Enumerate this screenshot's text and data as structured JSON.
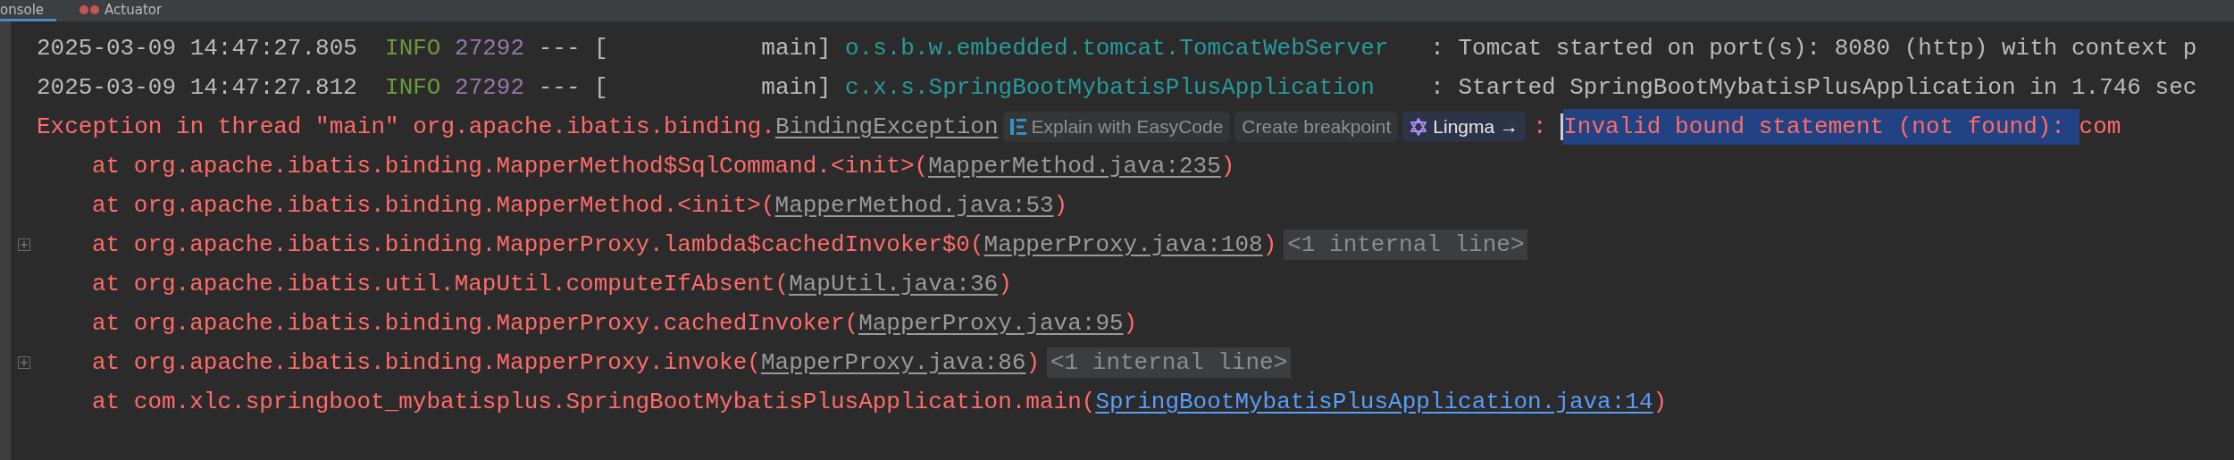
{
  "tabs": [
    {
      "label": "onsole",
      "selected": true
    },
    {
      "label": "Actuator",
      "selected": false
    }
  ],
  "lines": [
    {
      "kind": "log",
      "timestamp": "2025-03-09 14:47:27.805",
      "level": "INFO",
      "pid": "27292",
      "dashes": "---",
      "thread": "[           main]",
      "logger": "o.s.b.w.embedded.tomcat.TomcatWebServer",
      "message": ": Tomcat started on port(s): 8080 (http) with context p"
    },
    {
      "kind": "log",
      "timestamp": "2025-03-09 14:47:27.812",
      "level": "INFO",
      "pid": "27292",
      "dashes": "---",
      "thread": "[           main]",
      "logger": "c.x.s.SpringBootMybatisPlusApplication",
      "message": ": Started SpringBootMybatisPlusApplication in 1.746 sec"
    },
    {
      "kind": "exception",
      "prefix": "Exception in thread \"main\" org.apache.ibatis.binding.",
      "link": "BindingException",
      "hints": [
        {
          "kind": "easycode",
          "label": "Explain with EasyCode"
        },
        {
          "kind": "plain",
          "label": "Create breakpoint"
        },
        {
          "kind": "lingma",
          "label": "Lingma",
          "arrow": "→"
        }
      ],
      "separator": ":",
      "message": "Invalid bound statement (not found): ",
      "message_selected": true,
      "tail": "com"
    },
    {
      "kind": "trace",
      "text": "at org.apache.ibatis.binding.MapperMethod$SqlCommand.<init>(",
      "link": "MapperMethod.java:235",
      "in_project": false,
      "close": ")"
    },
    {
      "kind": "trace",
      "text": "at org.apache.ibatis.binding.MapperMethod.<init>(",
      "link": "MapperMethod.java:53",
      "in_project": false,
      "close": ")"
    },
    {
      "kind": "trace",
      "text": "at org.apache.ibatis.binding.MapperProxy.lambda$cachedInvoker$0(",
      "link": "MapperProxy.java:108",
      "in_project": false,
      "close": ")",
      "folded": "<1 internal line>"
    },
    {
      "kind": "trace",
      "text": "at org.apache.ibatis.util.MapUtil.computeIfAbsent(",
      "link": "MapUtil.java:36",
      "in_project": false,
      "close": ")"
    },
    {
      "kind": "trace",
      "text": "at org.apache.ibatis.binding.MapperProxy.cachedInvoker(",
      "link": "MapperProxy.java:95",
      "in_project": false,
      "close": ")"
    },
    {
      "kind": "trace",
      "text": "at org.apache.ibatis.binding.MapperProxy.invoke(",
      "link": "MapperProxy.java:86",
      "in_project": false,
      "close": ")",
      "folded": "<1 internal line>"
    },
    {
      "kind": "trace",
      "text": "at com.xlc.springboot_mybatisplus.SpringBootMybatisPlusApplication.main(",
      "link": "SpringBootMybatisPlusApplication.java:14",
      "in_project": true,
      "close": ")"
    }
  ]
}
